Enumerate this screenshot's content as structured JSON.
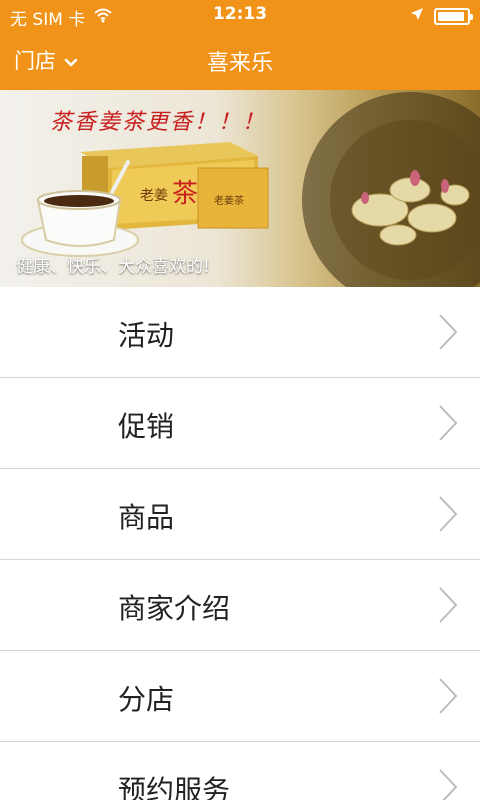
{
  "status_bar": {
    "carrier": "无 SIM 卡",
    "time": "12:13",
    "wifi_icon": "wifi-icon",
    "location_icon": "location-arrow-icon",
    "battery_icon": "battery-icon"
  },
  "navbar": {
    "store_label": "门店",
    "title": "喜来乐",
    "background": "#f19219"
  },
  "banner": {
    "headline": "茶香姜茶更香！！！",
    "package_text": "老姜茶",
    "caption": "健康、快乐、大众喜欢的!"
  },
  "menu": {
    "items": [
      {
        "label": "活动"
      },
      {
        "label": "促销"
      },
      {
        "label": "商品"
      },
      {
        "label": "商家介绍"
      },
      {
        "label": "分店"
      },
      {
        "label": "预约服务"
      }
    ]
  }
}
